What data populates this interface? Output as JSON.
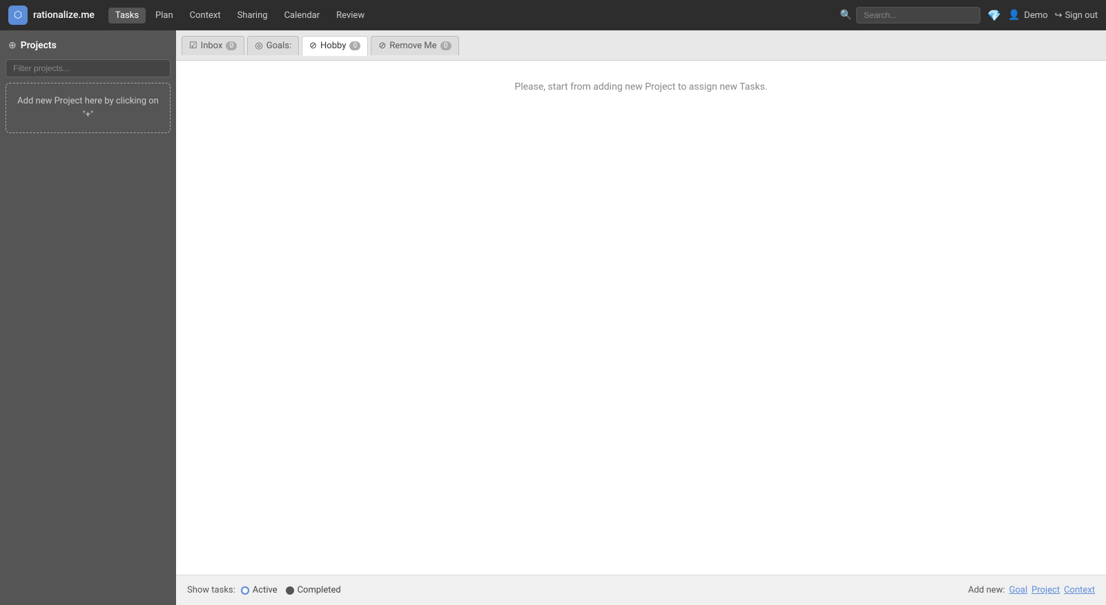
{
  "topnav": {
    "logo_icon": "⬡",
    "logo_text": "rationalize.me",
    "nav_items": [
      {
        "label": "Tasks",
        "active": true
      },
      {
        "label": "Plan",
        "active": false
      },
      {
        "label": "Context",
        "active": false
      },
      {
        "label": "Sharing",
        "active": false
      },
      {
        "label": "Calendar",
        "active": false
      },
      {
        "label": "Review",
        "active": false
      }
    ],
    "search_placeholder": "Search...",
    "user_name": "Demo",
    "signout_label": "Sign out"
  },
  "sidebar": {
    "header_label": "Projects",
    "filter_placeholder": "Filter projects...",
    "add_project_hint": "Add new Project here by clicking on \"+\""
  },
  "tabs": [
    {
      "label": "Inbox",
      "icon": "☑",
      "count": "0",
      "active": false
    },
    {
      "label": "Goals:",
      "icon": "◎",
      "count": null,
      "active": false
    },
    {
      "label": "Hobby",
      "icon": "⊘",
      "count": "0",
      "active": true
    },
    {
      "label": "Remove Me",
      "icon": "⊘",
      "count": "0",
      "active": false
    }
  ],
  "main": {
    "empty_message": "Please, start from adding new Project to assign new Tasks."
  },
  "bottom_bar": {
    "show_tasks_label": "Show tasks:",
    "radio_active_label": "Active",
    "radio_completed_label": "Completed",
    "add_new_label": "Add new:",
    "add_new_links": [
      {
        "label": "Goal"
      },
      {
        "label": "Project"
      },
      {
        "label": "Context"
      }
    ]
  }
}
